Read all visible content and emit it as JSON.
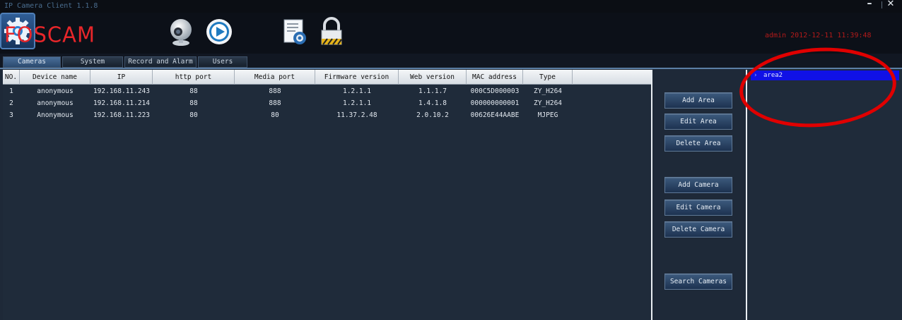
{
  "window": {
    "title": "IP Camera Client 1.1.8"
  },
  "header": {
    "logo_text": "FOSCAM",
    "user": "admin",
    "datetime": "2012-12-11  11:39:48",
    "toolbar_icons": [
      "webcam-icon",
      "play-icon",
      "settings-icon",
      "record-icon",
      "lock-icon"
    ],
    "active_icon": "settings-icon"
  },
  "tabs": [
    {
      "label": "Cameras",
      "active": true
    },
    {
      "label": "System",
      "active": false
    },
    {
      "label": "Record and Alarm",
      "active": false
    },
    {
      "label": "Users",
      "active": false
    }
  ],
  "table": {
    "columns": [
      "NO.",
      "Device name",
      "IP",
      "http port",
      "Media port",
      "Firmware version",
      "Web version",
      "MAC address",
      "Type"
    ],
    "rows": [
      [
        "1",
        "anonymous",
        "192.168.11.243",
        "88",
        "888",
        "1.2.1.1",
        "1.1.1.7",
        "000C5D000003",
        "ZY_H264"
      ],
      [
        "2",
        "anonymous",
        "192.168.11.214",
        "88",
        "888",
        "1.2.1.1",
        "1.4.1.8",
        "000000000001",
        "ZY_H264"
      ],
      [
        "3",
        "Anonymous",
        "192.168.11.223",
        "80",
        "80",
        "11.37.2.48",
        "2.0.10.2",
        "00626E44AABE",
        "MJPEG"
      ]
    ]
  },
  "buttons": {
    "add_area": "Add Area",
    "edit_area": "Edit Area",
    "delete_area": "Delete Area",
    "add_camera": "Add Camera",
    "edit_camera": "Edit Camera",
    "delete_camera": "Delete Camera",
    "search_cameras": "Search Cameras"
  },
  "area_tree": {
    "items": [
      {
        "label": "area2",
        "selected": true
      }
    ]
  },
  "colors": {
    "background": "#1e2938",
    "logo": "#e8262a",
    "selection": "#1011e6",
    "annotation": "#e00000"
  }
}
